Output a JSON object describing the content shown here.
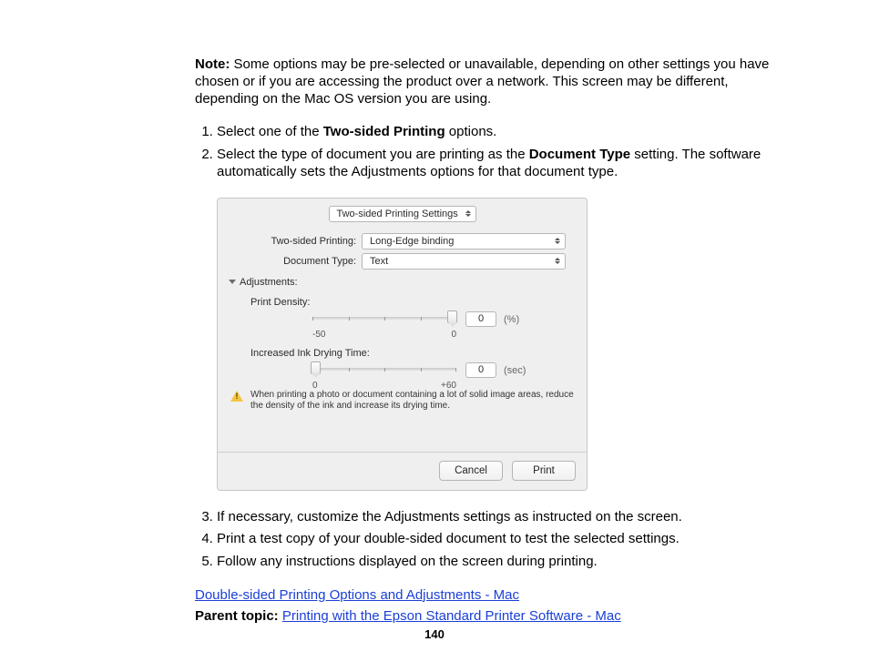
{
  "note": {
    "label": "Note:",
    "text": " Some options may be pre-selected or unavailable, depending on other settings you have chosen or if you are accessing the product over a network. This screen may be different, depending on the Mac OS version you are using."
  },
  "steps_a": {
    "s1_pre": "Select one of the ",
    "s1_bold": "Two-sided Printing",
    "s1_post": " options.",
    "s2_pre": "Select the type of document you are printing as the ",
    "s2_bold": "Document Type",
    "s2_post": " setting. The software automatically sets the Adjustments options for that document type."
  },
  "dialog": {
    "pane": "Two-sided Printing Settings",
    "tsp_label": "Two-sided Printing:",
    "tsp_value": "Long-Edge binding",
    "dt_label": "Document Type:",
    "dt_value": "Text",
    "adjust_label": "Adjustments:",
    "pd_label": "Print Density:",
    "pd_min": "-50",
    "pd_max": "0",
    "pd_value": "0",
    "pd_unit": "(%)",
    "idt_label": "Increased Ink Drying Time:",
    "idt_min": "0",
    "idt_max": "+60",
    "idt_value": "0",
    "idt_unit": "(sec)",
    "warn_text": "When printing a photo or document containing a lot of solid image areas, reduce the density of the ink and increase its drying time.",
    "cancel": "Cancel",
    "print": "Print"
  },
  "steps_b": {
    "s3": "If necessary, customize the Adjustments settings as instructed on the screen.",
    "s4": "Print a test copy of your double-sided document to test the selected settings.",
    "s5": "Follow any instructions displayed on the screen during printing."
  },
  "link_text": "Double-sided Printing Options and Adjustments - Mac",
  "parent_label": "Parent topic:",
  "parent_link": "Printing with the Epson Standard Printer Software - Mac",
  "page_number": "140"
}
